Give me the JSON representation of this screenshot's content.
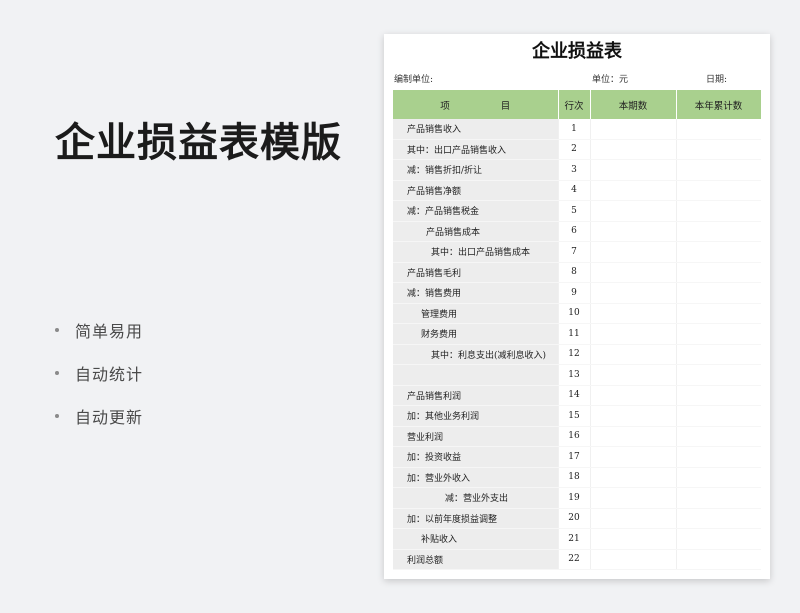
{
  "hero": {
    "title": "企业损益表模版",
    "features": [
      "简单易用",
      "自动统计",
      "自动更新"
    ]
  },
  "sheet": {
    "title": "企业损益表",
    "unit_name_label": "编制单位:",
    "unit_label": "单位：元",
    "date_label": "日期:",
    "columns": {
      "item_left": "项",
      "item_right": "目",
      "line_no": "行次",
      "current_period": "本期数",
      "year_to_date": "本年累计数"
    },
    "rows": [
      {
        "label": "产品销售收入",
        "no": "1",
        "indent": 0
      },
      {
        "label": "其中：出口产品销售收入",
        "no": "2",
        "indent": 0
      },
      {
        "label": "减：销售折扣/折让",
        "no": "3",
        "indent": 0
      },
      {
        "label": "产品销售净额",
        "no": "4",
        "indent": 0
      },
      {
        "label": "减：产品销售税金",
        "no": "5",
        "indent": 0
      },
      {
        "label": "产品销售成本",
        "no": "6",
        "indent": 2
      },
      {
        "label": "其中：出口产品销售成本",
        "no": "7",
        "indent": 3
      },
      {
        "label": "产品销售毛利",
        "no": "8",
        "indent": 0
      },
      {
        "label": "减：销售费用",
        "no": "9",
        "indent": 0
      },
      {
        "label": "管理费用",
        "no": "10",
        "indent": 1
      },
      {
        "label": "财务费用",
        "no": "11",
        "indent": 1
      },
      {
        "label": "其中：利息支出(减利息收入)",
        "no": "12",
        "indent": 3
      },
      {
        "label": "",
        "no": "13",
        "indent": 0
      },
      {
        "label": "产品销售利润",
        "no": "14",
        "indent": 0
      },
      {
        "label": "加：其他业务利润",
        "no": "15",
        "indent": 0
      },
      {
        "label": "营业利润",
        "no": "16",
        "indent": 0
      },
      {
        "label": "加：投资收益",
        "no": "17",
        "indent": 0
      },
      {
        "label": "加：营业外收入",
        "no": "18",
        "indent": 0
      },
      {
        "label": "减：营业外支出",
        "no": "19",
        "indent": 4
      },
      {
        "label": "加：以前年度损益调整",
        "no": "20",
        "indent": 0
      },
      {
        "label": "补贴收入",
        "no": "21",
        "indent": 1
      },
      {
        "label": "利润总额",
        "no": "22",
        "indent": 0
      }
    ]
  },
  "colors": {
    "header_green": "#a9d08e",
    "item_column_gray": "#ededed",
    "page_background": "#f1f2f4"
  }
}
